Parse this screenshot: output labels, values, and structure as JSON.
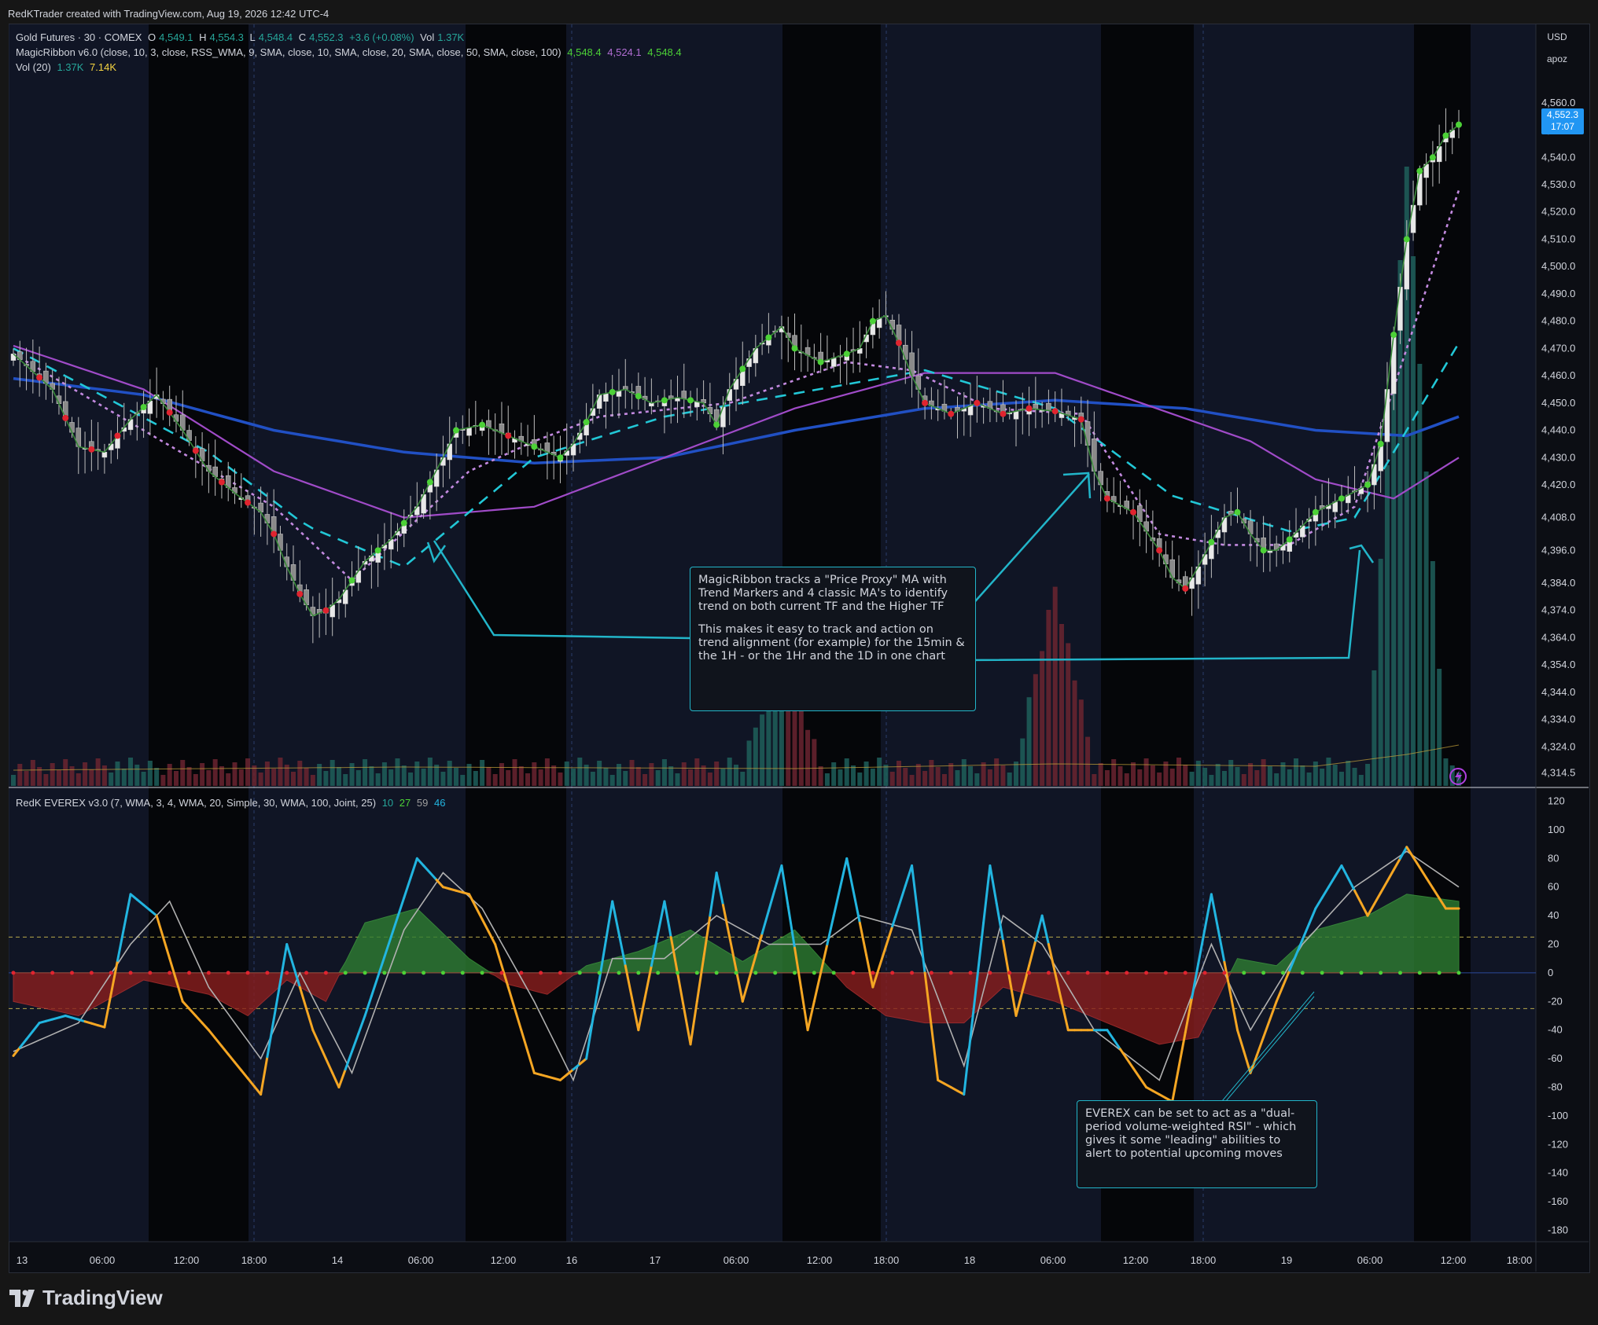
{
  "header": {
    "text": "RedKTrader created with TradingView.com, Aug 19, 2026 12:42 UTC-4"
  },
  "legend": {
    "symbol_line": {
      "name": "Gold Futures · 30 · COMEX",
      "o_label": "O",
      "o": "4,549.1",
      "h_label": "H",
      "h": "4,554.3",
      "l_label": "L",
      "l": "4,548.4",
      "c_label": "C",
      "c": "4,552.3",
      "change": "+3.6 (+0.08%)",
      "vol_label": "Vol",
      "vol": "1.37K"
    },
    "ribbon_line": {
      "name": "MagicRibbon v6.0 (close, 10, 3, close, RSS_WMA, 9, SMA, close, 10, SMA, close, 20, SMA, close, 50, SMA, close, 100)",
      "v1": "4,548.4",
      "v2": "4,524.1",
      "v3": "4,548.4",
      "c1": "#4cd137",
      "c2": "#b26ed4",
      "c3": "#4cd137"
    },
    "vol_line": {
      "name": "Vol (20)",
      "v1": "1.37K",
      "v2": "7.14K",
      "c1": "#26a69a",
      "c2": "#f5d442"
    },
    "everex_line": {
      "name": "RedK EVEREX v3.0 (7, WMA, 3, 4, WMA, 20, Simple, 30, WMA, 100, Joint, 25)",
      "v1": "10",
      "v2": "27",
      "v3": "59",
      "v4": "46",
      "c1": "#26a69a",
      "c2": "#4cd137",
      "c3": "#9e9e9e",
      "c4": "#22b5e0"
    }
  },
  "price_axis": {
    "currency": "USD",
    "mode": "apoz",
    "last_price": "4,552.3",
    "countdown": "17:07"
  },
  "notes": {
    "magicribbon": [
      "MagicRibbon tracks a \"Price Proxy\" MA with Trend Markers and 4 classic MA's to identify trend on both current TF and the Higher TF",
      "This makes it easy to track and action on trend alignment (for example) for the 15min & the 1H - or the 1Hr and the 1D in one chart"
    ],
    "everex": "EVEREX can be set to act as a \"dual-period volume-weighted RSI\" - which gives it some \"leading\" abilities to alert to potential upcoming moves"
  },
  "logo": {
    "text": "TradingView"
  },
  "colors": {
    "up": "#9e9e9e",
    "down": "#d0d0d0",
    "proxy_up": "#4cd137",
    "proxy_down": "#e0242f",
    "ma_cyan": "#22c7d6",
    "ma_violet": "#c38ae0",
    "ma_purple": "#a04bc8",
    "ma_blue": "#2150c4",
    "everex_pos": "#2e7d32",
    "everex_neg": "#8a1e1e",
    "line_bull": "#22b5e0",
    "line_bear": "#f5a623",
    "annotation": "#22b5c9"
  },
  "chart_data": [
    {
      "type": "candlestick",
      "title": "Gold Futures · 30 · COMEX",
      "x_ticks": [
        "13",
        "06:00",
        "12:00",
        "18:00",
        "14",
        "06:00",
        "12:00",
        "16",
        "17",
        "06:00",
        "12:00",
        "18:00",
        "18",
        "06:00",
        "12:00",
        "18:00",
        "19",
        "06:00",
        "12:00",
        "18:00"
      ],
      "y_ticks": [
        "4,560.0",
        "4,550.0",
        "4,540.0",
        "4,530.0",
        "4,520.0",
        "4,510.0",
        "4,500.0",
        "4,490.0",
        "4,480.0",
        "4,470.0",
        "4,460.0",
        "4,450.0",
        "4,440.0",
        "4,430.0",
        "4,420.0",
        "4,408.0",
        "4,396.0",
        "4,384.0",
        "4,374.0",
        "4,364.0",
        "4,354.0",
        "4,344.0",
        "4,334.0",
        "4,324.0",
        "4,314.5"
      ],
      "ylim": [
        4312,
        4566
      ],
      "close_path": [
        [
          0,
          4468
        ],
        [
          6,
          4455
        ],
        [
          10,
          4434
        ],
        [
          14,
          4432
        ],
        [
          18,
          4444
        ],
        [
          22,
          4453
        ],
        [
          26,
          4440
        ],
        [
          30,
          4425
        ],
        [
          34,
          4417
        ],
        [
          38,
          4410
        ],
        [
          40,
          4402
        ],
        [
          42,
          4390
        ],
        [
          44,
          4380
        ],
        [
          46,
          4372
        ],
        [
          48,
          4374
        ],
        [
          50,
          4378
        ],
        [
          54,
          4392
        ],
        [
          58,
          4400
        ],
        [
          62,
          4412
        ],
        [
          66,
          4430
        ],
        [
          68,
          4440
        ],
        [
          72,
          4442
        ],
        [
          76,
          4438
        ],
        [
          80,
          4434
        ],
        [
          84,
          4430
        ],
        [
          86,
          4435
        ],
        [
          88,
          4443
        ],
        [
          90,
          4453
        ],
        [
          94,
          4455
        ],
        [
          98,
          4450
        ],
        [
          102,
          4452
        ],
        [
          106,
          4450
        ],
        [
          108,
          4442
        ],
        [
          110,
          4455
        ],
        [
          114,
          4470
        ],
        [
          118,
          4478
        ],
        [
          120,
          4470
        ],
        [
          124,
          4465
        ],
        [
          128,
          4468
        ],
        [
          130,
          4470
        ],
        [
          132,
          4480
        ],
        [
          134,
          4482
        ],
        [
          136,
          4472
        ],
        [
          138,
          4460
        ],
        [
          140,
          4450
        ],
        [
          144,
          4446
        ],
        [
          148,
          4450
        ],
        [
          152,
          4446
        ],
        [
          156,
          4448
        ],
        [
          160,
          4447
        ],
        [
          164,
          4444
        ],
        [
          166,
          4425
        ],
        [
          168,
          4415
        ],
        [
          172,
          4410
        ],
        [
          176,
          4396
        ],
        [
          178,
          4386
        ],
        [
          180,
          4382
        ],
        [
          182,
          4390
        ],
        [
          186,
          4408
        ],
        [
          188,
          4410
        ],
        [
          190,
          4402
        ],
        [
          192,
          4396
        ],
        [
          194,
          4396
        ],
        [
          196,
          4400
        ],
        [
          200,
          4410
        ],
        [
          204,
          4415
        ],
        [
          208,
          4420
        ],
        [
          210,
          4435
        ],
        [
          212,
          4475
        ],
        [
          214,
          4510
        ],
        [
          216,
          4535
        ],
        [
          218,
          4540
        ],
        [
          220,
          4548
        ],
        [
          222,
          4552
        ]
      ],
      "price_proxy_color_flips": [
        [
          0,
          "down"
        ],
        [
          18,
          "up"
        ],
        [
          24,
          "down"
        ],
        [
          50,
          "up"
        ],
        [
          74,
          "down"
        ],
        [
          80,
          "up"
        ],
        [
          92,
          "up"
        ],
        [
          108,
          "up"
        ],
        [
          136,
          "down"
        ],
        [
          160,
          "down"
        ],
        [
          170,
          "down"
        ],
        [
          182,
          "up"
        ],
        [
          192,
          "up"
        ]
      ],
      "ma_10_path": [
        [
          0,
          4468
        ],
        [
          20,
          4440
        ],
        [
          40,
          4412
        ],
        [
          52,
          4385
        ],
        [
          70,
          4425
        ],
        [
          80,
          4436
        ],
        [
          90,
          4445
        ],
        [
          110,
          4450
        ],
        [
          128,
          4465
        ],
        [
          138,
          4462
        ],
        [
          150,
          4448
        ],
        [
          164,
          4446
        ],
        [
          176,
          4402
        ],
        [
          186,
          4398
        ],
        [
          196,
          4398
        ],
        [
          206,
          4412
        ],
        [
          214,
          4470
        ],
        [
          222,
          4528
        ]
      ],
      "ma_20_path": [
        [
          0,
          4470
        ],
        [
          30,
          4432
        ],
        [
          45,
          4405
        ],
        [
          60,
          4390
        ],
        [
          70,
          4410
        ],
        [
          80,
          4430
        ],
        [
          100,
          4445
        ],
        [
          126,
          4456
        ],
        [
          140,
          4462
        ],
        [
          160,
          4448
        ],
        [
          178,
          4416
        ],
        [
          196,
          4403
        ],
        [
          206,
          4408
        ],
        [
          222,
          4472
        ]
      ],
      "ma_50_path": [
        [
          0,
          4471
        ],
        [
          20,
          4455
        ],
        [
          40,
          4425
        ],
        [
          60,
          4408
        ],
        [
          80,
          4412
        ],
        [
          100,
          4430
        ],
        [
          120,
          4448
        ],
        [
          140,
          4461
        ],
        [
          160,
          4461
        ],
        [
          190,
          4436
        ],
        [
          200,
          4422
        ],
        [
          212,
          4415
        ],
        [
          222,
          4430
        ]
      ],
      "ma_100_path": [
        [
          0,
          4459
        ],
        [
          20,
          4453
        ],
        [
          40,
          4440
        ],
        [
          60,
          4432
        ],
        [
          80,
          4428
        ],
        [
          100,
          4430
        ],
        [
          120,
          4440
        ],
        [
          140,
          4448
        ],
        [
          160,
          4451
        ],
        [
          180,
          4448
        ],
        [
          200,
          4440
        ],
        [
          214,
          4438
        ],
        [
          222,
          4445
        ]
      ],
      "volume_spikes": [
        [
          118,
          8
        ],
        [
          160,
          12
        ],
        [
          214,
          40
        ]
      ]
    },
    {
      "type": "oscillator",
      "title": "RedK EVEREX v3.0 (7, WMA, 3, 4, WMA, 20, Simple, 30, WMA, 100, Joint, 25)",
      "y_ticks": [
        "120",
        "100",
        "80",
        "60",
        "40",
        "20",
        "0",
        "-20",
        "-40",
        "-60",
        "-80",
        "-100",
        "-120",
        "-140",
        "-160",
        "-180"
      ],
      "ylim": [
        -188,
        128
      ],
      "levels": [
        25,
        -25
      ],
      "fast_line": [
        [
          0,
          -58
        ],
        [
          4,
          -35
        ],
        [
          8,
          -30
        ],
        [
          14,
          -38
        ],
        [
          18,
          55
        ],
        [
          22,
          40
        ],
        [
          26,
          -20
        ],
        [
          30,
          -40
        ],
        [
          38,
          -85
        ],
        [
          42,
          20
        ],
        [
          46,
          -40
        ],
        [
          50,
          -80
        ],
        [
          54,
          -30
        ],
        [
          62,
          80
        ],
        [
          66,
          60
        ],
        [
          70,
          55
        ],
        [
          74,
          20
        ],
        [
          80,
          -70
        ],
        [
          84,
          -75
        ],
        [
          88,
          -60
        ],
        [
          92,
          50
        ],
        [
          96,
          -40
        ],
        [
          100,
          50
        ],
        [
          104,
          -50
        ],
        [
          108,
          70
        ],
        [
          112,
          -20
        ],
        [
          118,
          75
        ],
        [
          122,
          -40
        ],
        [
          128,
          80
        ],
        [
          132,
          -10
        ],
        [
          138,
          75
        ],
        [
          142,
          -75
        ],
        [
          146,
          -85
        ],
        [
          150,
          75
        ],
        [
          154,
          -30
        ],
        [
          158,
          40
        ],
        [
          162,
          -40
        ],
        [
          168,
          -40
        ],
        [
          174,
          -80
        ],
        [
          178,
          -90
        ],
        [
          184,
          55
        ],
        [
          188,
          -40
        ],
        [
          190,
          -70
        ],
        [
          194,
          -20
        ],
        [
          200,
          45
        ],
        [
          204,
          75
        ],
        [
          208,
          40
        ],
        [
          214,
          88
        ],
        [
          220,
          45
        ]
      ],
      "slow_line": [
        [
          0,
          -55
        ],
        [
          10,
          -35
        ],
        [
          18,
          20
        ],
        [
          24,
          50
        ],
        [
          30,
          -10
        ],
        [
          38,
          -60
        ],
        [
          44,
          0
        ],
        [
          52,
          -70
        ],
        [
          60,
          30
        ],
        [
          66,
          70
        ],
        [
          72,
          45
        ],
        [
          80,
          -20
        ],
        [
          86,
          -75
        ],
        [
          92,
          10
        ],
        [
          100,
          10
        ],
        [
          108,
          40
        ],
        [
          116,
          20
        ],
        [
          124,
          20
        ],
        [
          130,
          40
        ],
        [
          138,
          30
        ],
        [
          146,
          -65
        ],
        [
          152,
          40
        ],
        [
          158,
          20
        ],
        [
          166,
          -40
        ],
        [
          176,
          -75
        ],
        [
          184,
          20
        ],
        [
          190,
          -40
        ],
        [
          198,
          20
        ],
        [
          206,
          60
        ],
        [
          214,
          85
        ],
        [
          222,
          60
        ]
      ],
      "balance_area": [
        [
          0,
          -20
        ],
        [
          10,
          -30
        ],
        [
          20,
          -5
        ],
        [
          30,
          -15
        ],
        [
          36,
          -30
        ],
        [
          42,
          -5
        ],
        [
          48,
          -20
        ],
        [
          54,
          35
        ],
        [
          62,
          45
        ],
        [
          70,
          10
        ],
        [
          76,
          -8
        ],
        [
          82,
          -15
        ],
        [
          88,
          5
        ],
        [
          96,
          15
        ],
        [
          104,
          30
        ],
        [
          112,
          8
        ],
        [
          120,
          30
        ],
        [
          128,
          -10
        ],
        [
          134,
          -30
        ],
        [
          140,
          -35
        ],
        [
          146,
          -35
        ],
        [
          152,
          -10
        ],
        [
          160,
          -20
        ],
        [
          168,
          -35
        ],
        [
          176,
          -50
        ],
        [
          182,
          -45
        ],
        [
          188,
          10
        ],
        [
          194,
          5
        ],
        [
          200,
          30
        ],
        [
          208,
          40
        ],
        [
          214,
          55
        ],
        [
          222,
          50
        ]
      ]
    }
  ]
}
